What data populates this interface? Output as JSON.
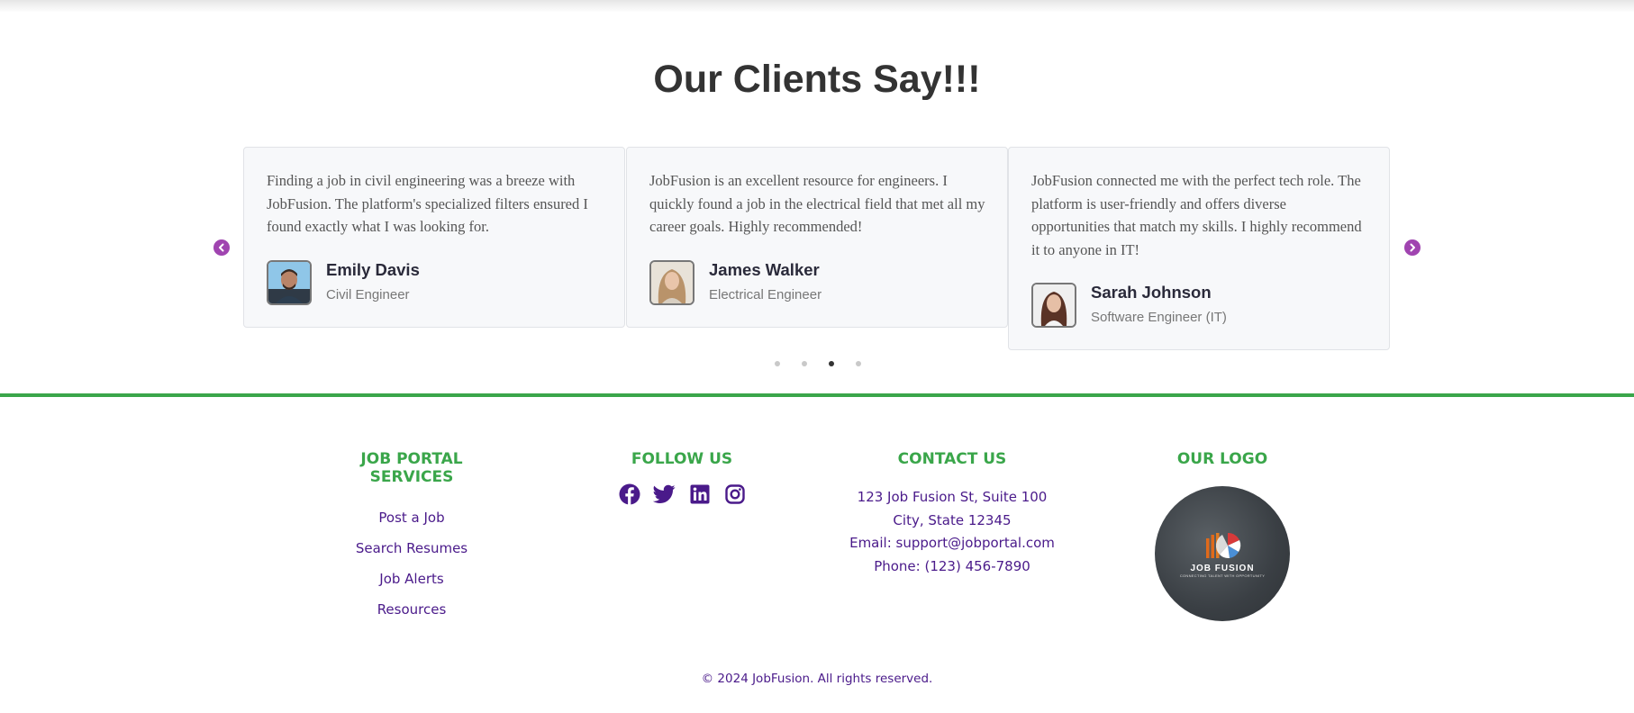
{
  "testimonials": {
    "title": "Our Clients Say!!!",
    "cards": [
      {
        "quote": "Finding a job in civil engineering was a breeze with JobFusion. The platform's specialized filters ensured I found exactly what I was looking for.",
        "name": "Emily Davis",
        "role": "Civil Engineer"
      },
      {
        "quote": "JobFusion is an excellent resource for engineers. I quickly found a job in the electrical field that met all my career goals. Highly recommended!",
        "name": "James Walker",
        "role": "Electrical Engineer"
      },
      {
        "quote": "JobFusion connected me with the perfect tech role. The platform is user-friendly and offers diverse opportunities that match my skills. I highly recommend it to anyone in IT!",
        "name": "Sarah Johnson",
        "role": "Software Engineer (IT)"
      }
    ],
    "active_dot": 3,
    "dot_count": 4
  },
  "footer": {
    "services": {
      "heading": "JOB PORTAL SERVICES",
      "links": [
        "Post a Job",
        "Search Resumes",
        "Job Alerts",
        "Resources"
      ]
    },
    "follow": {
      "heading": "FOLLOW US",
      "icons": [
        "facebook-icon",
        "twitter-icon",
        "linkedin-icon",
        "instagram-icon"
      ]
    },
    "contact": {
      "heading": "CONTACT US",
      "address_line1": "123 Job Fusion St, Suite 100",
      "address_line2": "City, State 12345",
      "email": "Email: support@jobportal.com",
      "phone": "Phone: (123) 456-7890"
    },
    "logo": {
      "heading": "OUR LOGO",
      "brand": "JOB FUSION",
      "tagline": "CONNECTING TALENT WITH OPPORTUNITY"
    },
    "copyright": "© 2024 JobFusion. All rights reserved."
  },
  "colors": {
    "accent_green": "#3aa64a",
    "link_purple": "#4a1a8a",
    "arrow_purple": "#a044b0"
  }
}
